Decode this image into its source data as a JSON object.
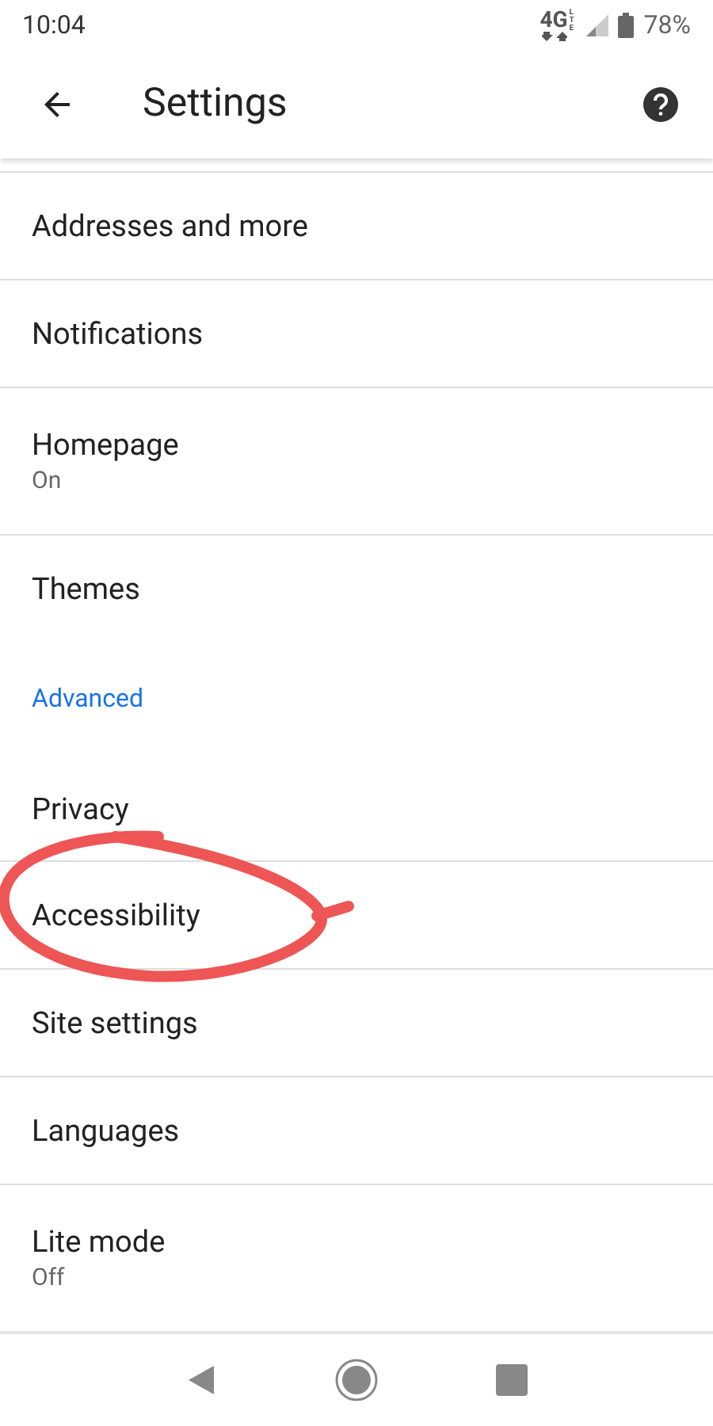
{
  "status_bar": {
    "time": "10:04",
    "network": "4G",
    "network_sub": "LTE",
    "battery": "78%"
  },
  "toolbar": {
    "title": "Settings"
  },
  "sections": [
    {
      "items": [
        {
          "label": "Addresses and more"
        },
        {
          "label": "Notifications"
        },
        {
          "label": "Homepage",
          "summary": "On"
        },
        {
          "label": "Themes"
        }
      ]
    },
    {
      "header": "Advanced",
      "items": [
        {
          "label": "Privacy"
        },
        {
          "label": "Accessibility"
        },
        {
          "label": "Site settings"
        },
        {
          "label": "Languages"
        },
        {
          "label": "Lite mode",
          "summary": "Off"
        }
      ]
    }
  ]
}
